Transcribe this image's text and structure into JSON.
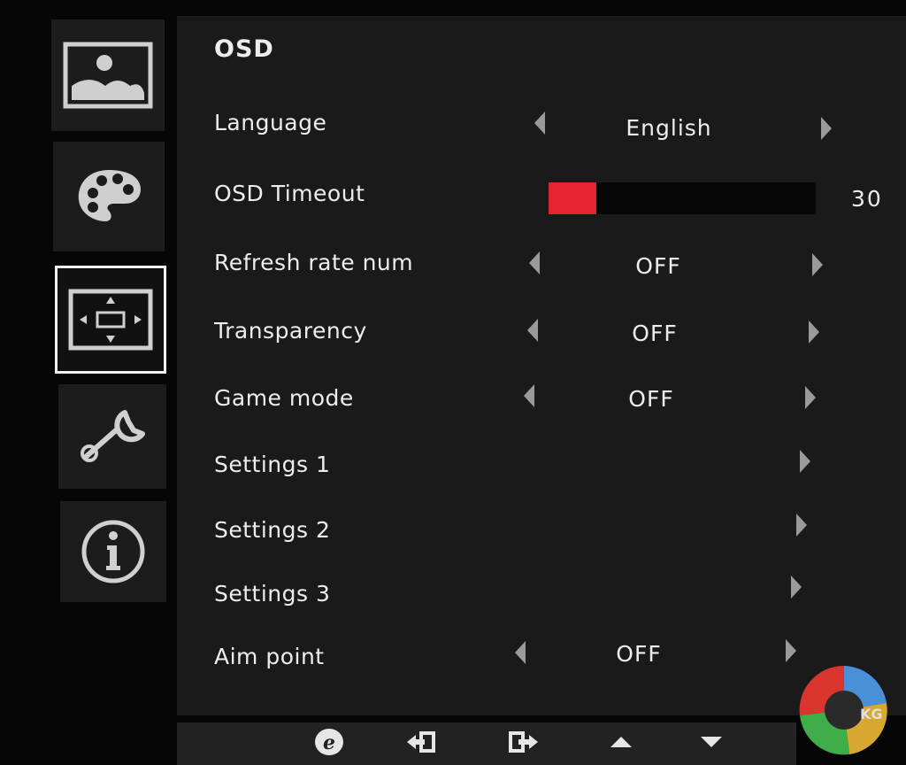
{
  "sidebar": {
    "items": [
      {
        "icon": "picture-icon",
        "active": false
      },
      {
        "icon": "palette-icon",
        "active": false
      },
      {
        "icon": "osd-position-icon",
        "active": true
      },
      {
        "icon": "wrench-icon",
        "active": false
      },
      {
        "icon": "info-icon",
        "active": false
      }
    ]
  },
  "menu": {
    "title": "OSD",
    "rows": [
      {
        "label": "Language",
        "value": "English",
        "control": "selector"
      },
      {
        "label": "OSD Timeout",
        "value": "30",
        "control": "slider",
        "level": 0.18
      },
      {
        "label": "Refresh rate num",
        "value": "OFF",
        "control": "selector"
      },
      {
        "label": "Transparency",
        "value": "OFF",
        "control": "selector"
      },
      {
        "label": "Game mode",
        "value": "OFF",
        "control": "selector"
      },
      {
        "label": "Settings 1",
        "value": "",
        "control": "submenu"
      },
      {
        "label": "Settings 2",
        "value": "",
        "control": "submenu"
      },
      {
        "label": "Settings 3",
        "value": "",
        "control": "submenu"
      },
      {
        "label": "Aim point",
        "value": "OFF",
        "control": "selector"
      }
    ]
  },
  "footer": {
    "buttons": [
      "e-key-icon",
      "exit-icon",
      "enter-icon",
      "up-icon",
      "down-icon"
    ]
  },
  "colors": {
    "accent": "#e5262f",
    "panel": "#1a1a1a",
    "text": "#ededed"
  },
  "watermark": {
    "text": "KG"
  }
}
